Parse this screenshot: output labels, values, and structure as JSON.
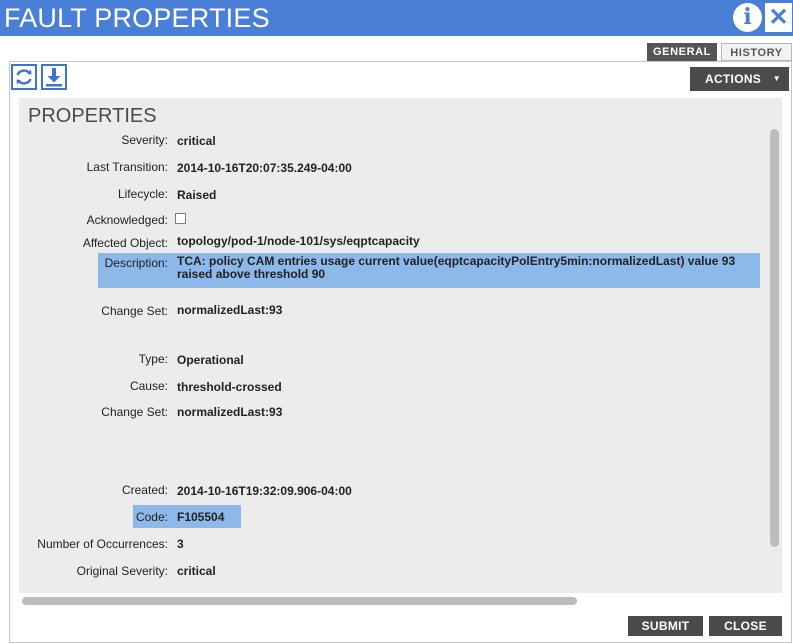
{
  "window": {
    "title": "FAULT PROPERTIES"
  },
  "header_icons": {
    "info": "info-icon",
    "close": "close-icon"
  },
  "tabs": [
    {
      "label": "GENERAL",
      "active": true
    },
    {
      "label": "HISTORY",
      "active": false
    }
  ],
  "toolbar": {
    "refresh_icon": "refresh-icon",
    "download_icon": "download-icon",
    "actions_label": "ACTIONS"
  },
  "panel": {
    "title": "PROPERTIES"
  },
  "properties": {
    "severity": {
      "label": "Severity:",
      "value": "critical"
    },
    "last_transition": {
      "label": "Last Transition:",
      "value": "2014-10-16T20:07:35.249-04:00"
    },
    "lifecycle": {
      "label": "Lifecycle:",
      "value": "Raised"
    },
    "acknowledged": {
      "label": "Acknowledged:",
      "checked": false
    },
    "affected_object": {
      "label": "Affected Object:",
      "value": "topology/pod-1/node-101/sys/eqptcapacity"
    },
    "description": {
      "label": "Description:",
      "value": "TCA: policy CAM entries usage current value(eqptcapacityPolEntry5min:normalizedLast) value 93 raised above  threshold 90"
    },
    "change_set_1": {
      "label": "Change Set:",
      "value": "normalizedLast:93"
    },
    "type": {
      "label": "Type:",
      "value": "Operational"
    },
    "cause": {
      "label": "Cause:",
      "value": "threshold-crossed"
    },
    "change_set_2": {
      "label": "Change Set:",
      "value": "normalizedLast:93"
    },
    "created": {
      "label": "Created:",
      "value": "2014-10-16T19:32:09.906-04:00"
    },
    "code": {
      "label": "Code:",
      "value": "F105504"
    },
    "occurrences": {
      "label": "Number of Occurrences:",
      "value": "3"
    },
    "original_severity": {
      "label": "Original Severity:",
      "value": "critical"
    }
  },
  "footer": {
    "submit_label": "SUBMIT",
    "close_label": "CLOSE"
  },
  "colors": {
    "title_bar": "#4a7fd8",
    "highlight": "#8db8ea",
    "panel_bg": "#ececec",
    "button_dark": "#4b4b4b"
  }
}
